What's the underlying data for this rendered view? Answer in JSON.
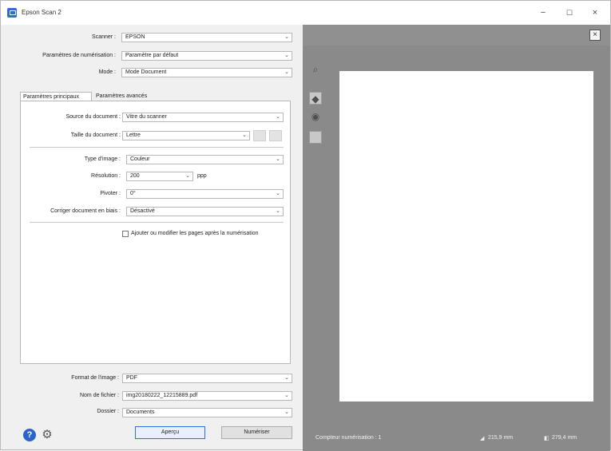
{
  "window": {
    "title": "Epson Scan 2",
    "controls": {
      "minimize": "−",
      "maximize": "☐",
      "close": "×"
    }
  },
  "left": {
    "scanner": {
      "label": "Scanner :",
      "value": "EPSON"
    },
    "scan_settings": {
      "label": "Paramètres de numérisation :",
      "value": "Paramètre par défaut"
    },
    "mode": {
      "label": "Mode :",
      "value": "Mode Document"
    },
    "tabs": [
      {
        "label": "Paramètres principaux",
        "active": true
      },
      {
        "label": "Paramètres avancés",
        "active": false
      }
    ],
    "main_settings": {
      "document_source": {
        "label": "Source du document :",
        "value": "Vitre du scanner"
      },
      "document_size": {
        "label": "Taille du document :",
        "value": "Lettre"
      },
      "image_type": {
        "label": "Type d'image :",
        "value": "Couleur"
      },
      "resolution": {
        "label": "Résolution :",
        "value": "200",
        "unit": "ppp"
      },
      "rotate": {
        "label": "Pivoter :",
        "value": "0°"
      },
      "deskew": {
        "label": "Corriger document en biais :",
        "value": "Désactivé"
      },
      "add_edit_pages": {
        "label": "Ajouter ou modifier les pages après la numérisation",
        "checked": false
      }
    },
    "output": {
      "image_format": {
        "label": "Format de l'image :",
        "value": "PDF"
      },
      "file_name": {
        "label": "Nom de fichier :",
        "value": "img20180222_12215889.pdf"
      },
      "folder": {
        "label": "Dossier :",
        "value": "Documents"
      }
    },
    "buttons": {
      "preview": "Aperçu",
      "scan": "Numériser"
    }
  },
  "right": {
    "status": {
      "counter": "Compteur numérisation : 1",
      "width": "215,9 mm",
      "height": "279,4 mm"
    }
  }
}
